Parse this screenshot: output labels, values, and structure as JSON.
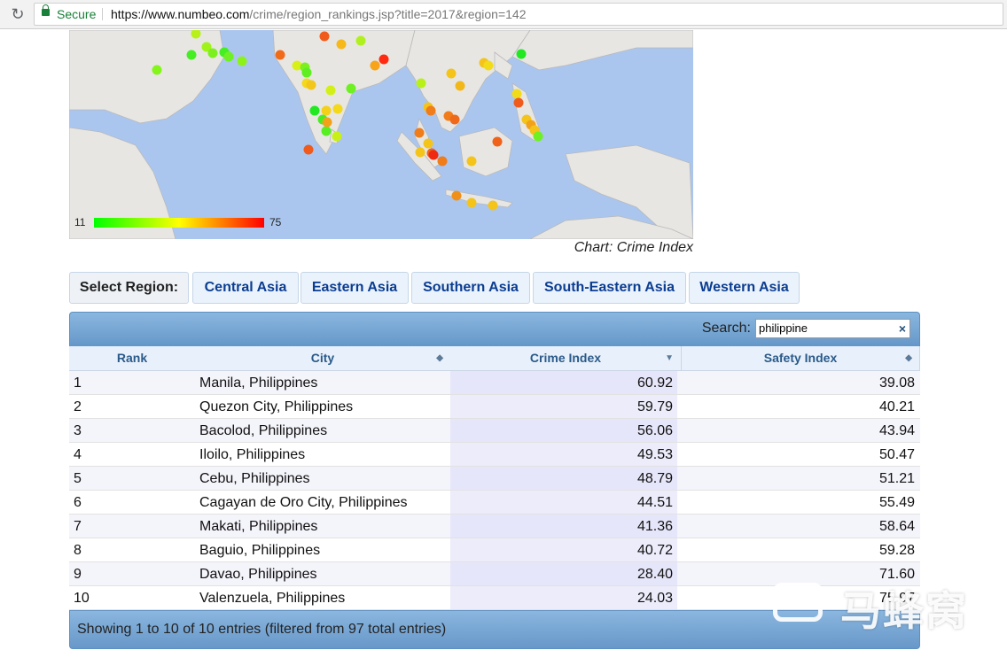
{
  "browser": {
    "secure_label": "Secure",
    "url_host": "https://www.numbeo.com",
    "url_rest": "/crime/region_rankings.jsp?title=2017&region=142"
  },
  "map": {
    "legend_min": "11",
    "legend_max": "75",
    "caption": "Chart: Crime Index",
    "colors": {
      "water": "#aac6ef",
      "land": "#e7e6e3",
      "border": "#b9b9b9",
      "low": "#00ff00",
      "mid": "#ffff00",
      "high": "#ff0000"
    }
  },
  "regions": {
    "label": "Select Region:",
    "items": [
      "Central Asia",
      "Eastern Asia",
      "Southern Asia",
      "South-Eastern Asia",
      "Western Asia"
    ]
  },
  "table": {
    "search_label": "Search:",
    "search_value": "philippine",
    "clear_symbol": "×",
    "headers": {
      "rank": "Rank",
      "city": "City",
      "crime": "Crime Index",
      "safety": "Safety Index"
    },
    "rows": [
      {
        "rank": "1",
        "city": "Manila, Philippines",
        "crime": "60.92",
        "safety": "39.08"
      },
      {
        "rank": "2",
        "city": "Quezon City, Philippines",
        "crime": "59.79",
        "safety": "40.21"
      },
      {
        "rank": "3",
        "city": "Bacolod, Philippines",
        "crime": "56.06",
        "safety": "43.94"
      },
      {
        "rank": "4",
        "city": "Iloilo, Philippines",
        "crime": "49.53",
        "safety": "50.47"
      },
      {
        "rank": "5",
        "city": "Cebu, Philippines",
        "crime": "48.79",
        "safety": "51.21"
      },
      {
        "rank": "6",
        "city": "Cagayan de Oro City, Philippines",
        "crime": "44.51",
        "safety": "55.49"
      },
      {
        "rank": "7",
        "city": "Makati, Philippines",
        "crime": "41.36",
        "safety": "58.64"
      },
      {
        "rank": "8",
        "city": "Baguio, Philippines",
        "crime": "40.72",
        "safety": "59.28"
      },
      {
        "rank": "9",
        "city": "Davao, Philippines",
        "crime": "28.40",
        "safety": "71.60"
      },
      {
        "rank": "10",
        "city": "Valenzuela, Philippines",
        "crime": "24.03",
        "safety": "75.97"
      }
    ],
    "footer": "Showing 1 to 10 of 10 entries (filtered from 97 total entries)"
  },
  "watermark": {
    "text": "马蜂窝"
  }
}
